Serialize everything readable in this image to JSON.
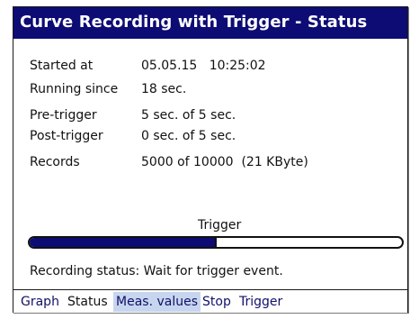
{
  "window": {
    "title": "Curve Recording with Trigger - Status"
  },
  "info": {
    "started": {
      "label": "Started at",
      "value": "05.05.15   10:25:02"
    },
    "running": {
      "label": "Running since",
      "value": "18 sec."
    },
    "pretrigger": {
      "label": "Pre-trigger",
      "value": "5 sec. of 5 sec."
    },
    "posttrigger": {
      "label": "Post-trigger",
      "value": "0 sec. of 5 sec."
    },
    "records": {
      "label": "Records",
      "value": "5000 of 10000  (21 KByte)"
    }
  },
  "trigger_bar": {
    "label": "Trigger",
    "progress_fraction": 0.5,
    "bar_color": "#0d0b74"
  },
  "status_text": "Recording status: Wait for trigger event.",
  "menu": {
    "graph": "Graph",
    "status": "Status",
    "meas_values": "Meas. values",
    "stop": "Stop",
    "trigger": "Trigger"
  },
  "colors": {
    "title_bg": "#0d0b74",
    "title_fg": "#ffffff",
    "highlight_bg": "#c7d6ee"
  }
}
